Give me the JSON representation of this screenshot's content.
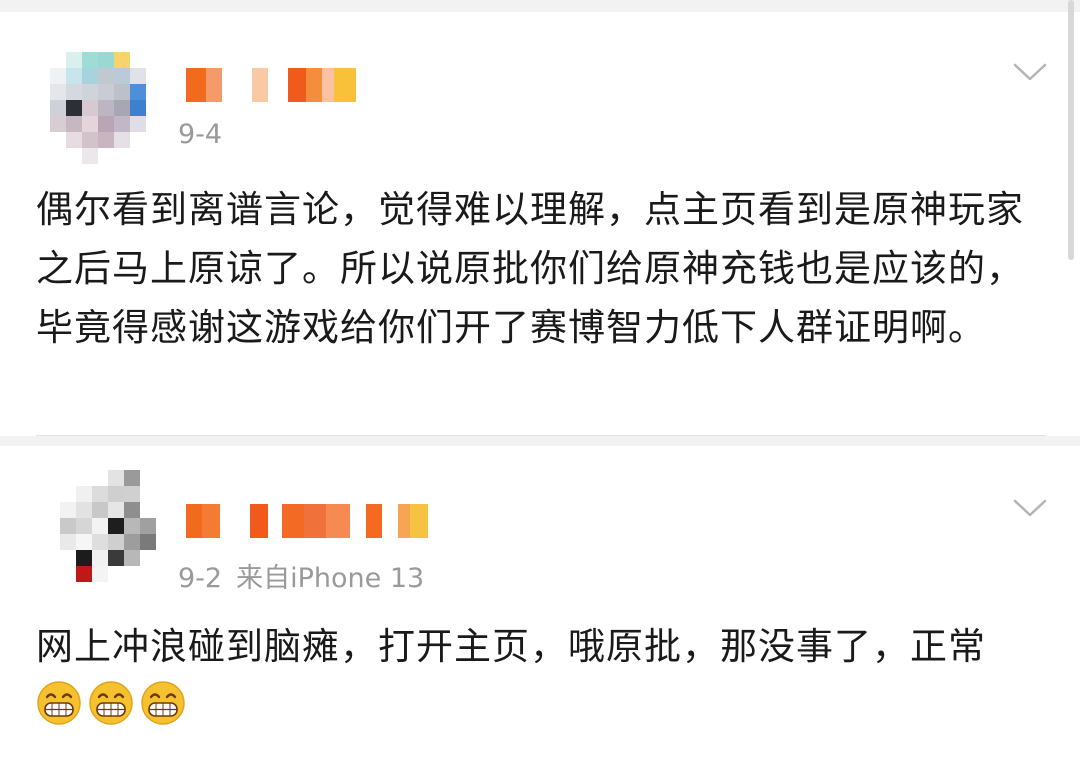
{
  "posts": [
    {
      "date": "9-4",
      "source": "",
      "text": "偶尔看到离谱言论，觉得难以理解，点主页看到是原神玩家之后马上原谅了。所以说原批你们给原神充钱也是应该的，毕竟得感谢这游戏给你们开了赛博智力低下人群证明啊。"
    },
    {
      "date": "9-2",
      "source": "来自iPhone 13",
      "text": "网上冲浪碰到脑瘫，打开主页，哦原批，那没事了，正常",
      "emoji": [
        "grin-emoji",
        "grin-emoji",
        "grin-emoji"
      ]
    }
  ],
  "icons": {
    "more": "chevron-down-icon"
  },
  "colors": {
    "name_accent": "#f26a1b",
    "meta_text": "#9a9a9a"
  }
}
